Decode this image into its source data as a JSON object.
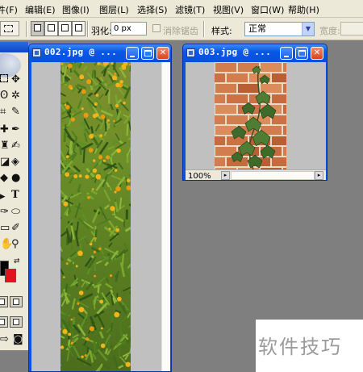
{
  "menubar": {
    "items": [
      "文件(F)",
      "编辑(E)",
      "图像(I)",
      "图层(L)",
      "选择(S)",
      "滤镜(T)",
      "视图(V)",
      "窗口(W)",
      "帮助(H)"
    ]
  },
  "options": {
    "feather_label": "羽化:",
    "feather_value": "0 px",
    "antialias_label": "消除锯齿",
    "style_label": "样式:",
    "style_value": "正常",
    "width_label": "宽度:"
  },
  "documents": [
    {
      "title": "002.jpg @ ...",
      "zoom": "",
      "content": "flower-field"
    },
    {
      "title": "003.jpg @ ...",
      "zoom": "100%",
      "content": "ivy-on-brick-wall"
    }
  ],
  "watermark": {
    "text": "软件技巧"
  },
  "colors": {
    "titlebar": "#0a58e6",
    "workspace": "#7f7f7f",
    "foreground": "#000000",
    "background_swatch": "#e0121c"
  }
}
